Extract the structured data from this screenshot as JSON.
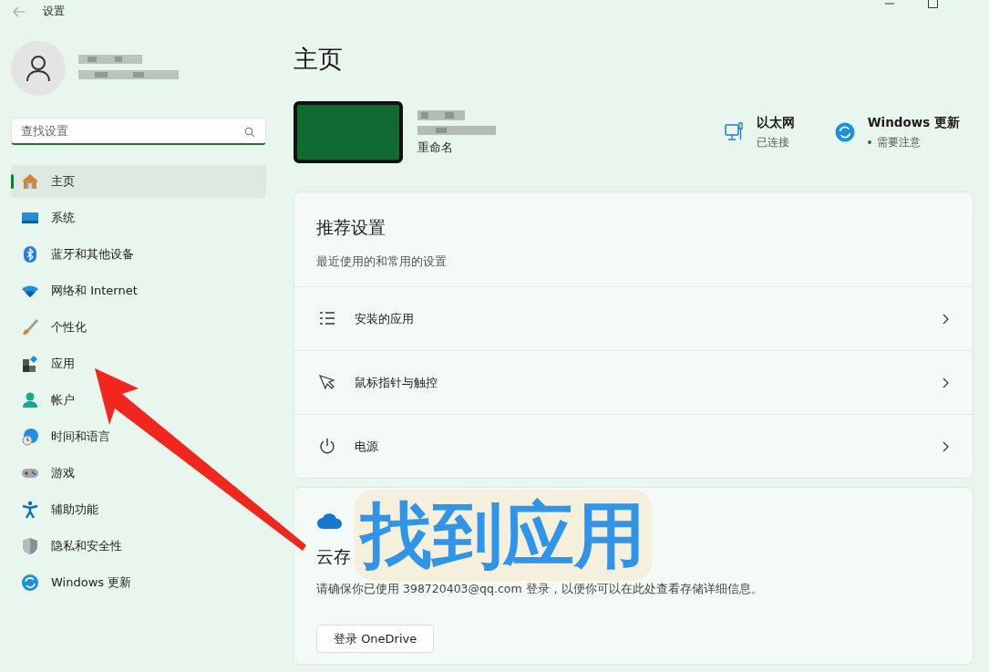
{
  "window": {
    "title": "设置"
  },
  "sidebar": {
    "search": {
      "placeholder": "查找设置"
    },
    "items": [
      {
        "label": "主页",
        "selected": true
      },
      {
        "label": "系统",
        "selected": false
      },
      {
        "label": "蓝牙和其他设备",
        "selected": false
      },
      {
        "label": "网络和 Internet",
        "selected": false
      },
      {
        "label": "个性化",
        "selected": false
      },
      {
        "label": "应用",
        "selected": false
      },
      {
        "label": "帐户",
        "selected": false
      },
      {
        "label": "时间和语言",
        "selected": false
      },
      {
        "label": "游戏",
        "selected": false
      },
      {
        "label": "辅助功能",
        "selected": false
      },
      {
        "label": "隐私和安全性",
        "selected": false
      },
      {
        "label": "Windows 更新",
        "selected": false
      }
    ]
  },
  "main": {
    "title": "主页",
    "device": {
      "rename_link": "重命名"
    },
    "status": [
      {
        "title": "以太网",
        "subtitle": "已连接",
        "kind": "network"
      },
      {
        "title": "Windows 更新",
        "subtitle": "需要注意",
        "kind": "update"
      }
    ],
    "recommended": {
      "title": "推荐设置",
      "subtitle": "最近使用的和常用的设置",
      "rows": [
        {
          "label": "安装的应用"
        },
        {
          "label": "鼠标指针与触控"
        },
        {
          "label": "电源"
        }
      ]
    },
    "cloud": {
      "title": "云存",
      "description": "请确保你已使用 398720403@qq.com 登录，以便你可以在此处查看存储详细信息。",
      "button": "登录 OneDrive"
    }
  },
  "annotation": {
    "text": "找到应用"
  }
}
